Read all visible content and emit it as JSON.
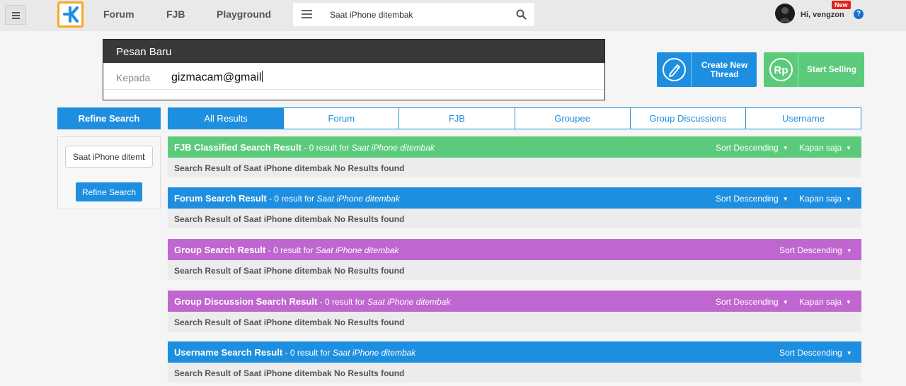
{
  "topbar": {
    "nav": [
      "Forum",
      "FJB",
      "Playground"
    ],
    "search_value": "Saat iPhone ditembak",
    "greeting": "Hi, vengzon",
    "new_badge": "New",
    "help": "?"
  },
  "message": {
    "title": "Pesan Baru",
    "to_label": "Kepada",
    "to_value": "gizmacam@gmail"
  },
  "cta": {
    "create_thread": "Create New Thread",
    "start_selling": "Start Selling",
    "create_color": "#1e8fe0",
    "selling_color": "#5bcb7b"
  },
  "sidebar": {
    "title": "Refine Search",
    "input_value": "Saat iPhone ditemb",
    "button": "Refine Search"
  },
  "tabs": [
    "All Results",
    "Forum",
    "FJB",
    "Groupee",
    "Group Discussions",
    "Username"
  ],
  "sections": [
    {
      "title": "FJB Classified Search Result",
      "sub": " - 0 result for ",
      "query": "Saat iPhone ditembak",
      "sort": "Sort Descending",
      "time": "Kapan saja",
      "body": "Search Result of Saat iPhone ditembak No Results found",
      "color": "green"
    },
    {
      "title": "Forum Search Result",
      "sub": " - 0 result for ",
      "query": "Saat iPhone ditembak",
      "sort": "Sort Descending",
      "time": "Kapan saja",
      "body": "Search Result of Saat iPhone ditembak No Results found",
      "color": "blue"
    },
    {
      "title": "Group Search Result",
      "sub": " - 0 result for ",
      "query": "Saat iPhone ditembak",
      "sort": "Sort Descending",
      "time": "",
      "body": "Search Result of Saat iPhone ditembak No Results found",
      "color": "purple"
    },
    {
      "title": "Group Discussion Search Result",
      "sub": " - 0 result for ",
      "query": "Saat iPhone ditembak",
      "sort": "Sort Descending",
      "time": "Kapan saja",
      "body": "Search Result of Saat iPhone ditembak No Results found",
      "color": "purple"
    },
    {
      "title": "Username Search Result",
      "sub": " - 0 result for ",
      "query": "Saat iPhone ditembak",
      "sort": "Sort Descending",
      "time": "",
      "body": "Search Result of Saat iPhone ditembak No Results found",
      "color": "blue"
    }
  ],
  "colors": {
    "green": "#5bcb7b",
    "blue": "#1e8fe0",
    "purple": "#c066d0",
    "logo_orange": "#f7a823"
  }
}
